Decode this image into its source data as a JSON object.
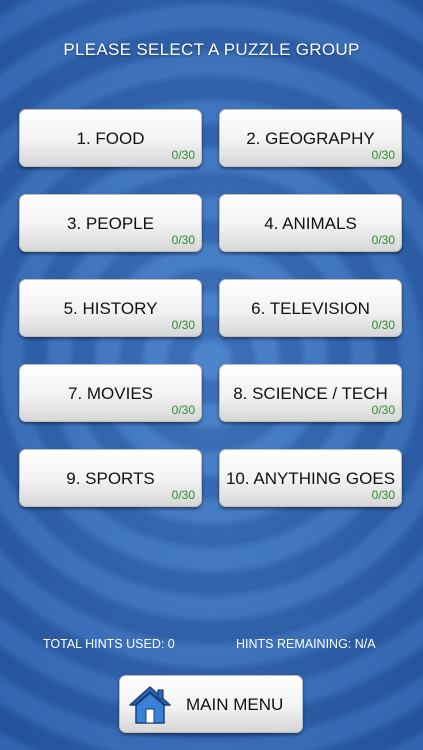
{
  "title": "PLEASE SELECT A PUZZLE GROUP",
  "groups": [
    {
      "label": "1. FOOD",
      "progress": "0/30"
    },
    {
      "label": "2. GEOGRAPHY",
      "progress": "0/30"
    },
    {
      "label": "3. PEOPLE",
      "progress": "0/30"
    },
    {
      "label": "4. ANIMALS",
      "progress": "0/30"
    },
    {
      "label": "5. HISTORY",
      "progress": "0/30"
    },
    {
      "label": "6. TELEVISION",
      "progress": "0/30"
    },
    {
      "label": "7. MOVIES",
      "progress": "0/30"
    },
    {
      "label": "8. SCIENCE / TECH",
      "progress": "0/30"
    },
    {
      "label": "9. SPORTS",
      "progress": "0/30"
    },
    {
      "label": "10. ANYTHING GOES",
      "progress": "0/30"
    }
  ],
  "stats": {
    "hints_used_label": "TOTAL HINTS USED:  0",
    "hints_remaining_label": "HINTS REMAINING:  N/A"
  },
  "main_menu": {
    "label": "MAIN MENU",
    "icon": "home-icon"
  },
  "colors": {
    "progress_text": "#2e8b2e",
    "background_blue": "#2a5ea8"
  }
}
